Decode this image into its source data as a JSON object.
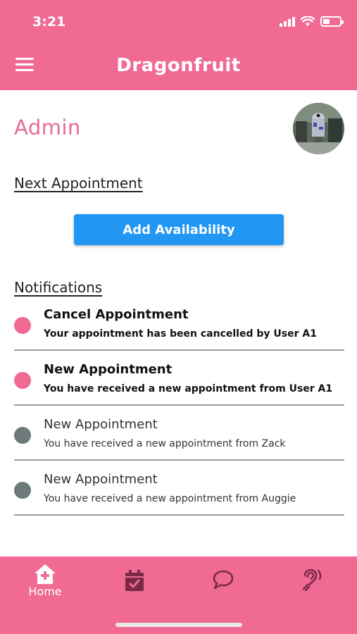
{
  "status": {
    "time": "3:21"
  },
  "header": {
    "title": "Dragonfruit",
    "menu_icon": "hamburger-menu-icon"
  },
  "profile": {
    "role_title": "Admin",
    "avatar_icon": "user-avatar"
  },
  "sections": {
    "next_appointment": "Next Appointment",
    "notifications": "Notifications"
  },
  "actions": {
    "add_availability": "Add Availability"
  },
  "notifications": [
    {
      "title": "Cancel Appointment",
      "body": "Your appointment has been cancelled by User A1",
      "unread": true
    },
    {
      "title": "New Appointment",
      "body": "You have received a new appointment from User A1",
      "unread": true
    },
    {
      "title": "New Appointment",
      "body": "You have received a new appointment from Zack",
      "unread": false
    },
    {
      "title": "New Appointment",
      "body": "You have received a new appointment from Auggie",
      "unread": false
    }
  ],
  "bottom_nav": {
    "home_label": "Home",
    "icons": [
      "home-icon",
      "calendar-check-icon",
      "chat-bubble-icon",
      "hearing-icon"
    ]
  },
  "colors": {
    "brand_pink": "#f06a94",
    "admin_pink": "#e46c90",
    "button_blue": "#2196f3",
    "read_dot": "#6c7a7a"
  }
}
